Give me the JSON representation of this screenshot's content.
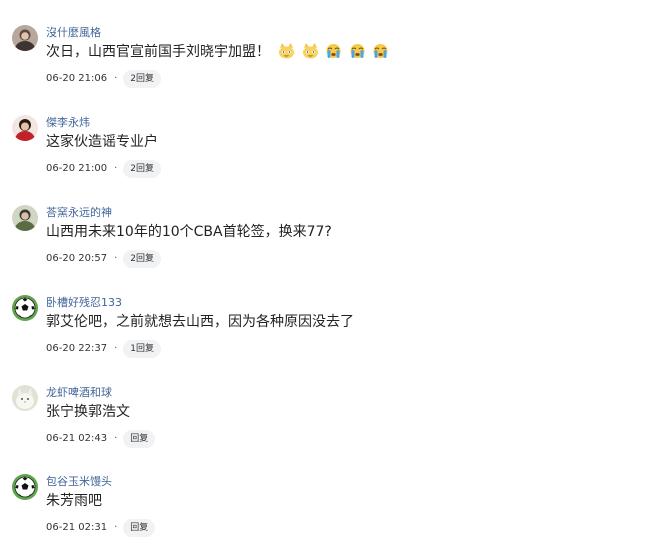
{
  "comments": [
    {
      "username": "沒什麼風格",
      "content": "次日，山西官宣前国手刘晓宇加盟！",
      "emojis": [
        "cat-face-emoji",
        "cat-face-emoji",
        "crying-face-emoji",
        "crying-face-emoji",
        "crying-face-emoji"
      ],
      "time": "06-20 21:06",
      "separator": "·",
      "reply_label": "2回复",
      "avatar": "avatar-person-dark"
    },
    {
      "username": "傑李永炜",
      "content": "这家伙造谣专业户",
      "time": "06-20 21:00",
      "separator": "·",
      "reply_label": "2回复",
      "avatar": "avatar-red-portrait"
    },
    {
      "username": "荅窯永远的神",
      "content": "山西用未来10年的10个CBA首轮签，换来77?",
      "time": "06-20 20:57",
      "separator": "·",
      "reply_label": "2回复",
      "avatar": "avatar-person-green"
    },
    {
      "username": "卧槽好残忍133",
      "content": "郭艾伦吧，之前就想去山西，因为各种原因没去了",
      "time": "06-20 22:37",
      "separator": "·",
      "reply_label": "1回复",
      "avatar": "avatar-soccer-ball"
    },
    {
      "username": "龙虾啤酒和球",
      "content": "张宁换郭浩文",
      "time": "06-21 02:43",
      "separator": "·",
      "reply_label": "回复",
      "avatar": "avatar-white-cat"
    },
    {
      "username": "包谷玉米馒头",
      "content": "朱芳雨吧",
      "time": "06-21 02:31",
      "separator": "·",
      "reply_label": "回复",
      "avatar": "avatar-soccer-ball"
    }
  ],
  "colors": {
    "username": "#406599",
    "content": "#222222",
    "reply_pill_bg": "#f1f2f4"
  }
}
